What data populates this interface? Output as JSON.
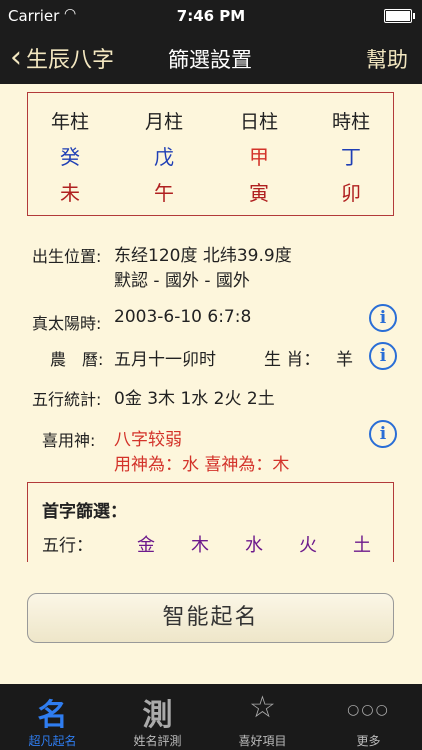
{
  "status": {
    "carrier": "Carrier",
    "time": "7:46 PM"
  },
  "nav": {
    "back_label": "生辰八字",
    "title": "篩選設置",
    "help_label": "幫助"
  },
  "pillars": {
    "headers": [
      "年柱",
      "月柱",
      "日柱",
      "時柱"
    ],
    "stems": [
      "癸",
      "戊",
      "甲",
      "丁"
    ],
    "branches": [
      "未",
      "午",
      "寅",
      "卯"
    ]
  },
  "info": {
    "birthplace_label": "出生位置:",
    "birthplace_line1": "东经120度 北纬39.9度",
    "birthplace_line2": "默認 - 國外 - 國外",
    "solar_label": "真太陽時:",
    "solar_value": "2003-6-10 6:7:8",
    "lunar_label": "農　曆:",
    "lunar_value": "五月十一卯时",
    "zodiac_label": "生 肖：",
    "zodiac_value": "羊",
    "wuxing_label": "五行統計:",
    "wuxing_value": "0金 3木 1水 2火 2土",
    "xiyong_label": "喜用神:",
    "xiyong_line1": "八字较弱",
    "xiyong_line2": "用神為：水  喜神為：木"
  },
  "filter": {
    "title": "首字篩選：",
    "wuxing_label": "五行：",
    "elements": [
      "金",
      "木",
      "水",
      "火",
      "土"
    ]
  },
  "smart_button": "智能起名",
  "tabs": [
    {
      "icon": "名",
      "label": "超凡起名"
    },
    {
      "icon": "測",
      "label": "姓名評測"
    },
    {
      "icon": "☆",
      "label": "喜好項目"
    },
    {
      "icon": "○○○",
      "label": "更多"
    }
  ],
  "colors": {
    "stem_blue": "#1f3fb5",
    "stem_red": "#d3332a",
    "element_purple": "#6d1a8c",
    "accent_blue": "#2f7df0"
  }
}
